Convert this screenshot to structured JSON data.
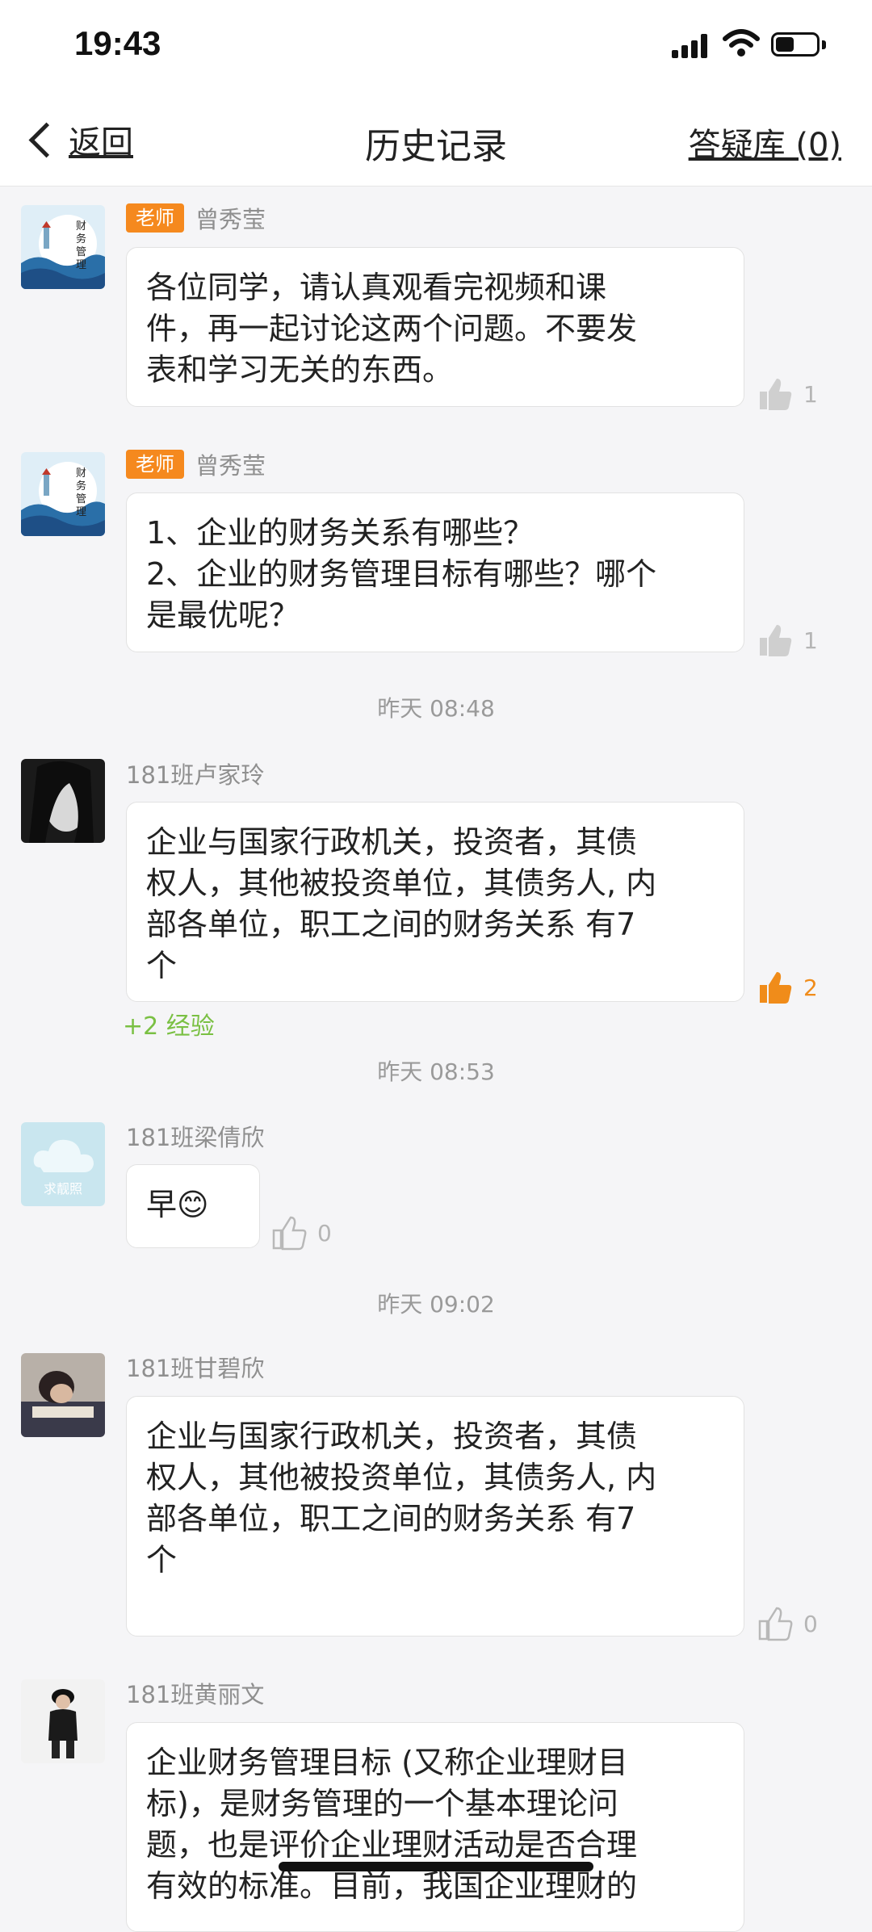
{
  "status": {
    "time": "19:43"
  },
  "nav": {
    "back_label": "返回",
    "title": "历史记录",
    "qa_label": "答疑库 (0)"
  },
  "colors": {
    "teacher_badge": "#f5891e",
    "like_active": "#f08c1a",
    "exp_green": "#7ac043"
  },
  "messages": [
    {
      "badge": "老师",
      "name": "曾秀莹",
      "text": "各位同学，请认真观看完视频和课\n件，再一起讨论这两个问题。不要发\n表和学习无关的东西。",
      "likes": "1",
      "avatar_icon": "finance-lighthouse-avatar"
    },
    {
      "badge": "老师",
      "name": "曾秀莹",
      "text": "1、企业的财务关系有哪些？\n2、企业的财务管理目标有哪些？哪个\n是最优呢？",
      "likes": "1",
      "avatar_icon": "finance-lighthouse-avatar"
    },
    {
      "time": "昨天 08:48",
      "name": "181班卢家玲",
      "text": "企业与国家行政机关，投资者，其债\n权人，其他被投资单位，其债务人, 内\n部各单位，职工之间的财务关系 有7\n个",
      "likes": "2",
      "liked": true,
      "exp": "+2 经验",
      "avatar_icon": "portrait-avatar"
    },
    {
      "time": "昨天 08:53",
      "name": "181班梁倩欣",
      "text": "早😊",
      "likes": "0",
      "avatar_icon": "default-cloud-avatar",
      "avatar_text": "求靓照"
    },
    {
      "time": "昨天 09:02",
      "name": "181班甘碧欣",
      "text": "企业与国家行政机关，投资者，其债\n权人，其他被投资单位，其债务人, 内\n部各单位，职工之间的财务关系 有7\n个",
      "likes": "0",
      "avatar_icon": "photo-avatar"
    },
    {
      "name": "181班黄丽文",
      "text": "企业财务管理目标 (又称企业理财目\n标)，是财务管理的一个基本理论问\n题，也是评价企业理财活动是否合理\n有效的标准。目前，我国企业理财的",
      "avatar_icon": "standing-figure-avatar"
    }
  ]
}
